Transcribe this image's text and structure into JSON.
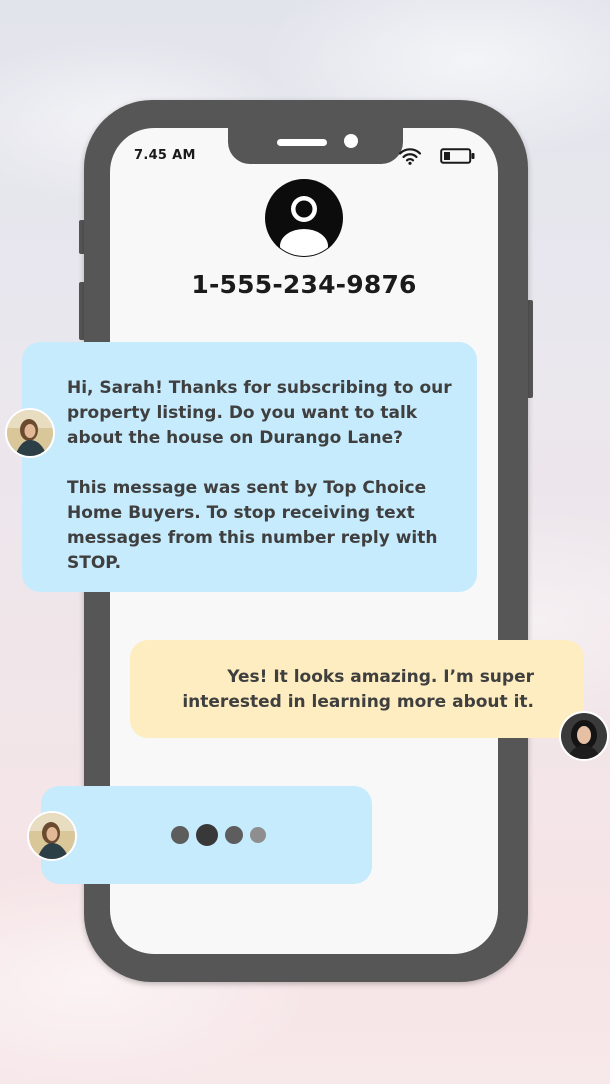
{
  "status_bar": {
    "time": "7.45 AM",
    "icons": [
      "wifi-icon",
      "battery-icon"
    ]
  },
  "contact": {
    "avatar_icon": "user-avatar-icon",
    "number": "1-555-234-9876"
  },
  "messages": [
    {
      "direction": "incoming",
      "paragraphs": [
        "Hi, Sarah! Thanks for subscribing to our property listing. Do you want to talk about the house on Durango Lane?",
        "This message was sent by Top Choice Home Buyers. To stop receiving text messages from this number reply with STOP."
      ],
      "avatar": "sender-avatar-photo"
    },
    {
      "direction": "outgoing",
      "text": "Yes! It looks amazing. I’m super interested in learning more about it.",
      "avatar": "recipient-avatar-photo"
    },
    {
      "direction": "incoming",
      "typing_indicator": true,
      "avatar": "sender-avatar-photo"
    }
  ],
  "colors": {
    "phone_frame": "#575656",
    "screen": "#f8f8f8",
    "incoming_bubble": "#c6ebfc",
    "outgoing_bubble": "#fdedc0",
    "text": "#3f3f3f"
  }
}
